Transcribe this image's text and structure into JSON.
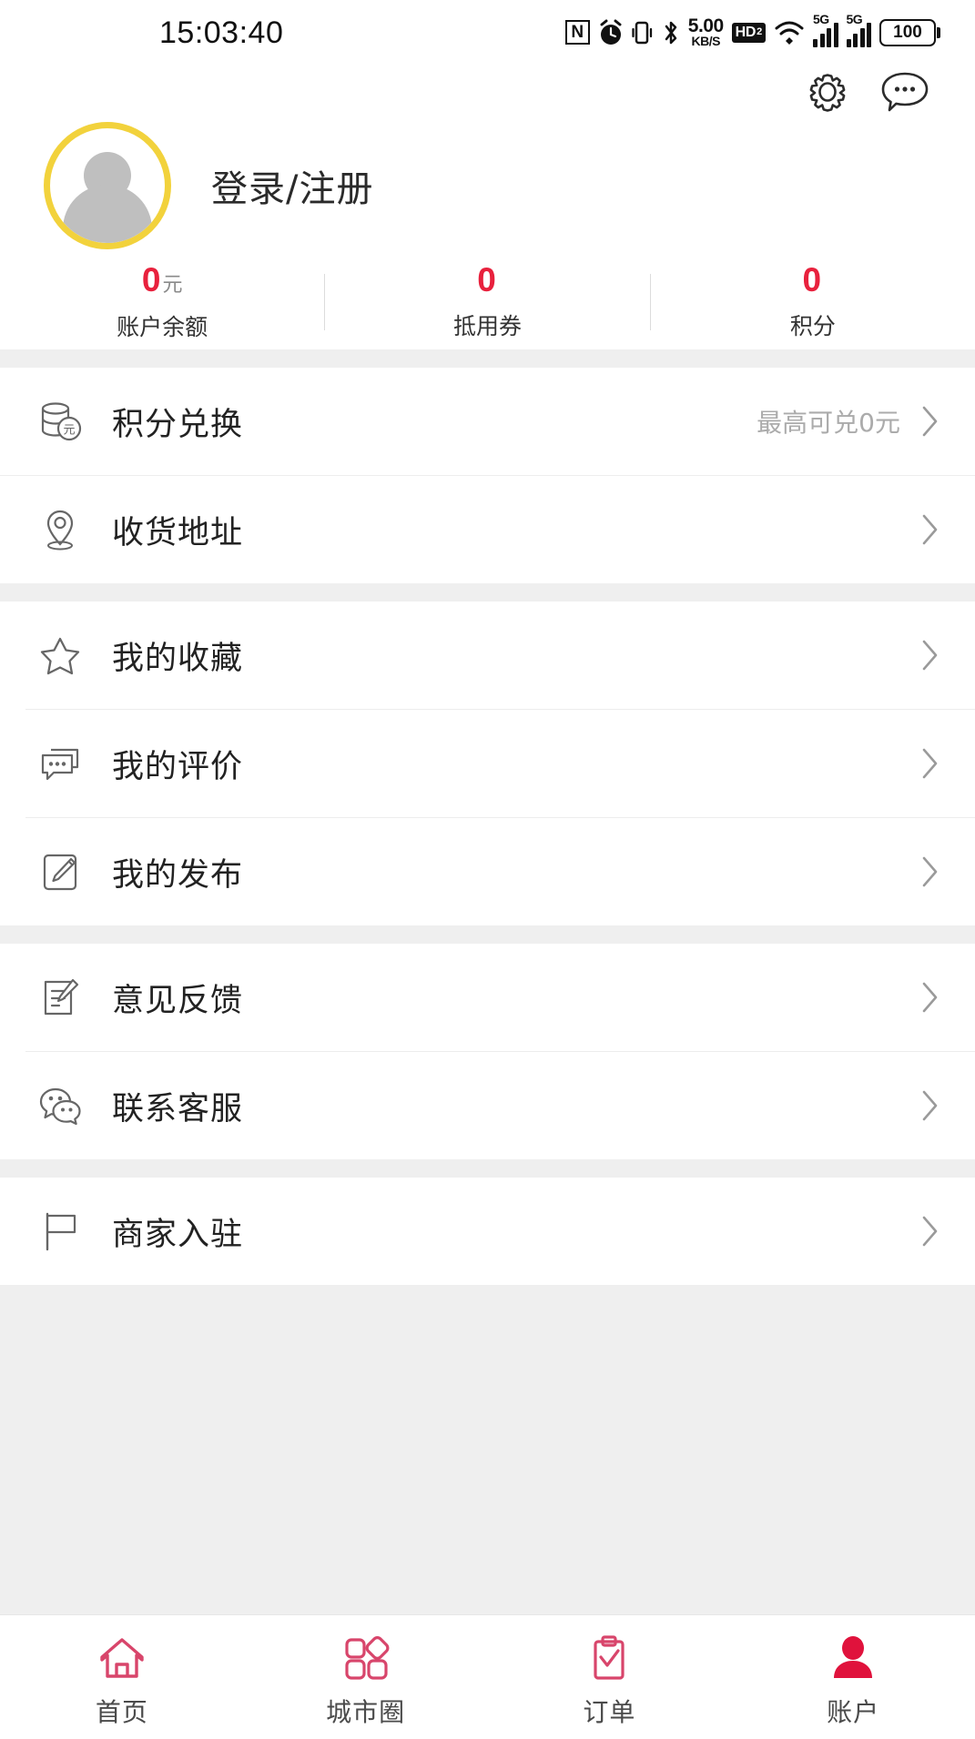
{
  "status_bar": {
    "time": "15:03:40",
    "nfc_label": "N",
    "data_speed_value": "5.00",
    "data_speed_unit": "KB/S",
    "hd_label": "HD",
    "hd_sub": "2",
    "sim1_network": "5G",
    "sim2_network": "5G",
    "battery_level": "100",
    "icons": [
      "nfc-icon",
      "alarm-icon",
      "vibrate-icon",
      "bluetooth-icon",
      "data-speed-icon",
      "hd-voice-icon",
      "wifi-icon",
      "signal-sim1-icon",
      "signal-sim2-icon",
      "battery-icon"
    ]
  },
  "header": {
    "settings_icon": "gear-icon",
    "message_icon": "speech-bubble-icon"
  },
  "profile": {
    "avatar_icon": "default-avatar-icon",
    "login_label": "登录/注册",
    "avatar_ring_color": "#F2D23C"
  },
  "stats": [
    {
      "value": "0",
      "unit": "元",
      "label": "账户余额",
      "name": "account-balance"
    },
    {
      "value": "0",
      "unit": "",
      "label": "抵用券",
      "name": "voucher"
    },
    {
      "value": "0",
      "unit": "",
      "label": "积分",
      "name": "points"
    }
  ],
  "stat_value_color": "#E8213D",
  "sections": [
    {
      "name": "section-assets",
      "rows": [
        {
          "name": "points-exchange",
          "icon": "coin-stack-icon",
          "label": "积分兑换",
          "right_text": "最高可兑0元",
          "chevron": true
        },
        {
          "name": "shipping-address",
          "icon": "location-pin-icon",
          "label": "收货地址",
          "right_text": "",
          "chevron": true
        }
      ]
    },
    {
      "name": "section-personal",
      "rows": [
        {
          "name": "my-favorites",
          "icon": "star-icon",
          "label": "我的收藏",
          "right_text": "",
          "chevron": true
        },
        {
          "name": "my-reviews",
          "icon": "comment-icon",
          "label": "我的评价",
          "right_text": "",
          "chevron": true
        },
        {
          "name": "my-posts",
          "icon": "edit-note-icon",
          "label": "我的发布",
          "right_text": "",
          "chevron": true
        }
      ]
    },
    {
      "name": "section-support",
      "rows": [
        {
          "name": "feedback",
          "icon": "feedback-document-icon",
          "label": "意见反馈",
          "right_text": "",
          "chevron": true
        },
        {
          "name": "contact-service",
          "icon": "wechat-chat-icon",
          "label": "联系客服",
          "right_text": "",
          "chevron": true
        }
      ]
    },
    {
      "name": "section-merchant",
      "rows": [
        {
          "name": "merchant-join",
          "icon": "flag-icon",
          "label": "商家入驻",
          "right_text": "",
          "chevron": true
        }
      ]
    }
  ],
  "bottom_nav": {
    "active_index": 3,
    "active_color": "#E0123C",
    "inactive_color": "#D8456B",
    "label_color": "#4a4a4a",
    "items": [
      {
        "name": "nav-home",
        "icon": "home-icon",
        "label": "首页"
      },
      {
        "name": "nav-city-circle",
        "icon": "grid-blocks-icon",
        "label": "城市圈"
      },
      {
        "name": "nav-orders",
        "icon": "clipboard-check-icon",
        "label": "订单"
      },
      {
        "name": "nav-account",
        "icon": "person-filled-icon",
        "label": "账户"
      }
    ]
  }
}
